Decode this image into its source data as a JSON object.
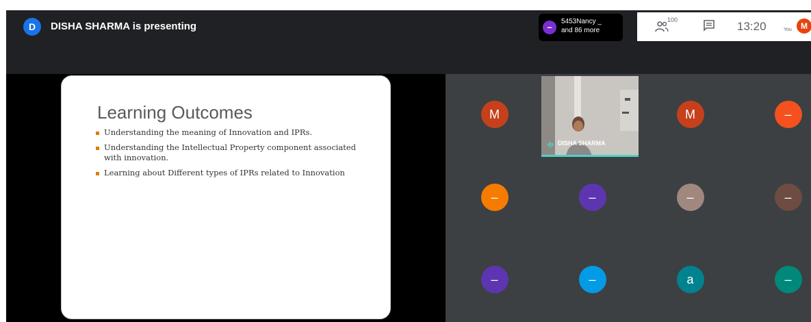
{
  "header": {
    "presenter_initial": "D",
    "presenter_text": "DISHA SHARMA is presenting"
  },
  "participants_chip": {
    "dot_symbol": "–",
    "line1": "5453Nancy _",
    "line2": "and 86 more"
  },
  "controls": {
    "people_count": "100",
    "time": "13:20",
    "you_label": "You",
    "self_initial": "M"
  },
  "slide": {
    "title": "Learning Outcomes",
    "bullets": [
      "Understanding the meaning of Innovation and IPRs.",
      "Understanding the Intellectual Property component associated with innovation.",
      "Learning about Different types of IPRs related to Innovation"
    ]
  },
  "video_tile": {
    "name": "DISHA SHARMA"
  },
  "tiles": [
    {
      "symbol": "M",
      "color": "#c5401b"
    },
    {
      "symbol": "M",
      "color": "#c5401b"
    },
    {
      "symbol": "–",
      "color": "#f4511e"
    },
    {
      "symbol": "–",
      "color": "#f57c00"
    },
    {
      "symbol": "–",
      "color": "#5e35b1"
    },
    {
      "symbol": "–",
      "color": "#a1887f"
    },
    {
      "symbol": "–",
      "color": "#6d4c41"
    },
    {
      "symbol": "–",
      "color": "#5e35b1"
    },
    {
      "symbol": "–",
      "color": "#039be5"
    },
    {
      "symbol": "a",
      "color": "#00838f"
    },
    {
      "symbol": "–",
      "color": "#00897b"
    }
  ]
}
